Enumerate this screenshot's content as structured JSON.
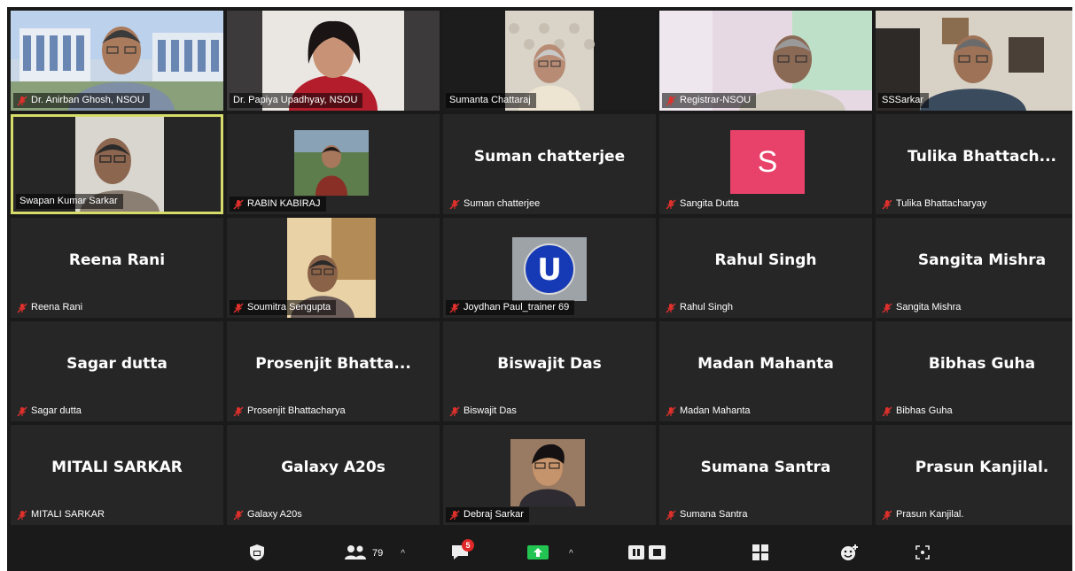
{
  "participants": [
    {
      "display": "",
      "tag": "Dr. Anirban  Ghosh, NSOU",
      "muted": true,
      "video": "campus"
    },
    {
      "display": "",
      "tag": "Dr. Papiya Upadhyay, NSOU",
      "muted": false,
      "video": "woman"
    },
    {
      "display": "",
      "tag": "Sumanta Chattaraj",
      "muted": false,
      "video": "curtain"
    },
    {
      "display": "",
      "tag": "Registrar-NSOU",
      "muted": true,
      "video": "room-pink"
    },
    {
      "display": "",
      "tag": "SSSarkar",
      "muted": false,
      "video": "office"
    },
    {
      "display": "",
      "tag": "Swapan Kumar Sarkar",
      "muted": false,
      "video": "man-glasses",
      "active": true
    },
    {
      "display": "",
      "tag": "RABIN KABIRAJ",
      "muted": true,
      "video": "photo-outdoor"
    },
    {
      "display": "Suman chatterjee",
      "tag": "Suman chatterjee",
      "muted": true
    },
    {
      "display": "",
      "tag": "Sangita Dutta",
      "muted": true,
      "avatar": "S"
    },
    {
      "display": "Tulika  Bhattach...",
      "tag": "Tulika Bhattacharyay",
      "muted": true
    },
    {
      "display": "Reena Rani",
      "tag": "Reena Rani",
      "muted": true
    },
    {
      "display": "",
      "tag": "Soumitra Sengupta",
      "muted": true,
      "video": "man-window"
    },
    {
      "display": "",
      "tag": "Joydhan Paul_trainer 69",
      "muted": true,
      "video": "logo"
    },
    {
      "display": "Rahul Singh",
      "tag": "Rahul Singh",
      "muted": true
    },
    {
      "display": "Sangita Mishra",
      "tag": "Sangita Mishra",
      "muted": true
    },
    {
      "display": "Sagar dutta",
      "tag": "Sagar dutta",
      "muted": true
    },
    {
      "display": "Prosenjit  Bhatta...",
      "tag": "Prosenjit Bhattacharya",
      "muted": true
    },
    {
      "display": "Biswajit Das",
      "tag": "Biswajit Das",
      "muted": true
    },
    {
      "display": "Madan Mahanta",
      "tag": "Madan Mahanta",
      "muted": true
    },
    {
      "display": "Bibhas Guha",
      "tag": "Bibhas Guha",
      "muted": true
    },
    {
      "display": "MITALI SARKAR",
      "tag": "MITALI SARKAR",
      "muted": true
    },
    {
      "display": "Galaxy A20s",
      "tag": "Galaxy A20s",
      "muted": true
    },
    {
      "display": "",
      "tag": "Debraj Sarkar",
      "muted": true,
      "video": "man-portrait"
    },
    {
      "display": "Sumana Santra",
      "tag": "Sumana Santra",
      "muted": true
    },
    {
      "display": "Prasun Kanjilal.",
      "tag": "Prasun Kanjilal.",
      "muted": true
    }
  ],
  "toolbar": {
    "participants_count": "79",
    "chat_badge": "5",
    "share_color": "#23c552",
    "badge_color": "#e02828",
    "active_border": "#d6dc6a",
    "icons": [
      "shield-icon",
      "participants-icon",
      "chat-icon",
      "share-screen-icon",
      "record-icon",
      "apps-icon",
      "reactions-icon",
      "more-icon"
    ]
  }
}
